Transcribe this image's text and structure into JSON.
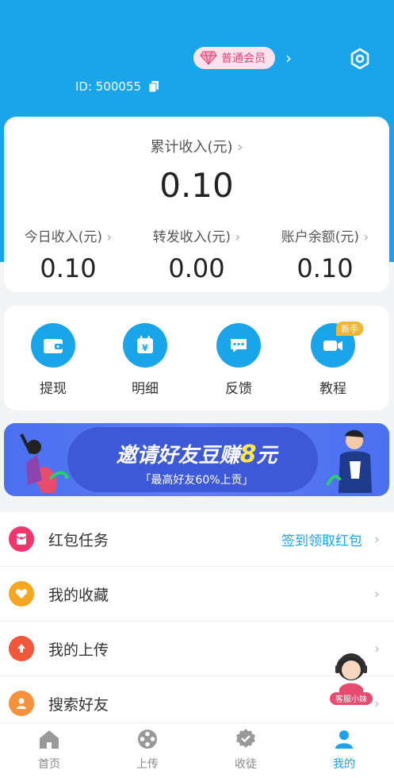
{
  "header": {
    "member_label": "普通会员",
    "user_id": "ID: 500055"
  },
  "income": {
    "total_label": "累计收入(元)",
    "total_value": "0.10",
    "today_label": "今日收入(元)",
    "today_value": "0.10",
    "forward_label": "转发收入(元)",
    "forward_value": "0.00",
    "balance_label": "账户余额(元)",
    "balance_value": "0.10"
  },
  "actions": [
    {
      "label": "提现",
      "icon": "wallet-icon"
    },
    {
      "label": "明细",
      "icon": "calendar-yen-icon"
    },
    {
      "label": "反馈",
      "icon": "chat-bubble-icon"
    },
    {
      "label": "教程",
      "icon": "video-camera-icon",
      "badge": "新手"
    }
  ],
  "banner": {
    "title_prefix": "邀请好友豆赚",
    "title_amount": "8",
    "title_suffix": "元",
    "subtitle": "「最高好友60%上贡」"
  },
  "menu": [
    {
      "label": "红包任务",
      "right": "签到领取红包",
      "icon": "red-packet-icon",
      "color": "#f0366b"
    },
    {
      "label": "我的收藏",
      "right": "",
      "icon": "heart-icon",
      "color": "#f5a623"
    },
    {
      "label": "我的上传",
      "right": "",
      "icon": "upload-icon",
      "color": "#f0573b"
    },
    {
      "label": "搜索好友",
      "right": "",
      "icon": "person-icon",
      "color": "#f5923b"
    }
  ],
  "support": {
    "label": "客服小妹"
  },
  "tabs": [
    {
      "label": "首页",
      "icon": "home-icon",
      "active": false
    },
    {
      "label": "上传",
      "icon": "film-reel-icon",
      "active": false
    },
    {
      "label": "收徒",
      "icon": "badge-check-icon",
      "active": false
    },
    {
      "label": "我的",
      "icon": "user-icon",
      "active": true
    }
  ],
  "colors": {
    "primary": "#1aa5ea",
    "member_text": "#e0457b",
    "banner": "#4a6ff0",
    "highlight": "#ffe94d"
  }
}
